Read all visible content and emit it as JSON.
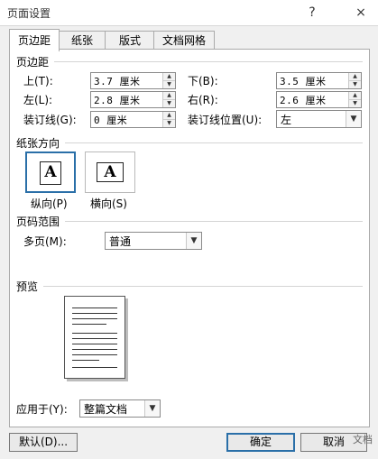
{
  "window": {
    "title": "页面设置",
    "help_label": "?",
    "close_label": "×"
  },
  "tabs": [
    {
      "label": "页边距"
    },
    {
      "label": "纸张"
    },
    {
      "label": "版式"
    },
    {
      "label": "文档网格"
    }
  ],
  "margins": {
    "section_title": "页边距",
    "top": {
      "label": "上(T):",
      "value": "3.7 厘米"
    },
    "bottom": {
      "label": "下(B):",
      "value": "3.5 厘米"
    },
    "left": {
      "label": "左(L):",
      "value": "2.8 厘米"
    },
    "right": {
      "label": "右(R):",
      "value": "2.6 厘米"
    },
    "gutter": {
      "label": "装订线(G):",
      "value": "0 厘米"
    },
    "gutter_position": {
      "label": "装订线位置(U):",
      "value": "左"
    }
  },
  "orientation": {
    "section_title": "纸张方向",
    "portrait_label": "纵向(P)",
    "landscape_label": "横向(S)",
    "glyph": "A"
  },
  "pages": {
    "section_title": "页码范围",
    "multiple_label": "多页(M):",
    "multiple_value": "普通"
  },
  "preview": {
    "section_title": "预览"
  },
  "apply_to": {
    "label": "应用于(Y):",
    "value": "整篇文档"
  },
  "buttons": {
    "default_label": "默认(D)...",
    "ok_label": "确定",
    "cancel_label": "取消"
  },
  "watermark": "文档"
}
